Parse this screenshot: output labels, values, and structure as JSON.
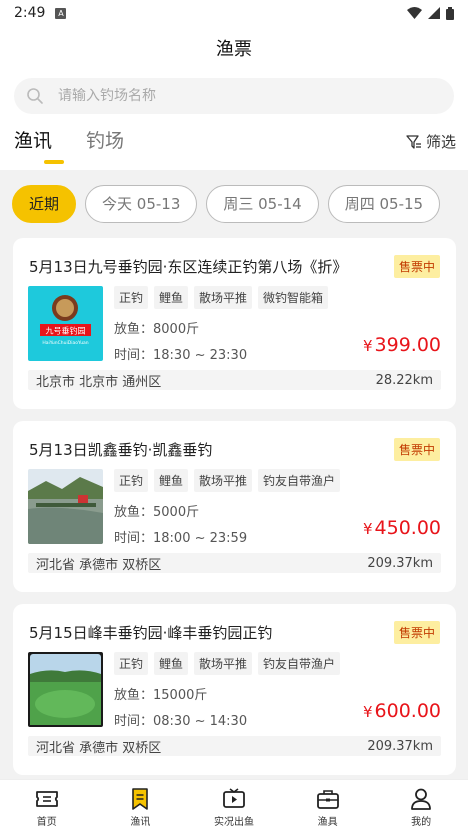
{
  "status": {
    "time": "2:49",
    "app_icon": "A"
  },
  "header": {
    "title": "渔票"
  },
  "search": {
    "placeholder": "请输入钓场名称"
  },
  "tabs": [
    {
      "label": "渔讯",
      "active": true
    },
    {
      "label": "钓场",
      "active": false
    }
  ],
  "filter": {
    "label": "筛选"
  },
  "dates": [
    {
      "label": "近期",
      "active": true
    },
    {
      "label": "今天 05-13",
      "active": false
    },
    {
      "label": "周三 05-14",
      "active": false
    },
    {
      "label": "周四 05-15",
      "active": false
    }
  ],
  "cards": [
    {
      "title": "5月13日九号垂钓园·东区连续正钓第八场《折》",
      "badge": "售票中",
      "tags": [
        "正钓",
        "鲤鱼",
        "散场平推",
        "微钓智能箱"
      ],
      "release": "放鱼：8000斤",
      "time": "时间：18:30 ~ 23:30",
      "currency": "¥",
      "price": "399.00",
      "location": "北京市 北京市 通州区",
      "distance": "28.22km",
      "thumb_text": "九号垂钓园",
      "thumb_sub": "HaiYunChuiDiaoYuan"
    },
    {
      "title": "5月13日凯鑫垂钓·凯鑫垂钓",
      "badge": "售票中",
      "tags": [
        "正钓",
        "鲤鱼",
        "散场平推",
        "钓友自带渔户"
      ],
      "release": "放鱼：5000斤",
      "time": "时间：18:00 ~ 23:59",
      "currency": "¥",
      "price": "450.00",
      "location": "河北省 承德市 双桥区",
      "distance": "209.37km"
    },
    {
      "title": "5月15日峰丰垂钓园·峰丰垂钓园正钓",
      "badge": "售票中",
      "tags": [
        "正钓",
        "鲤鱼",
        "散场平推",
        "钓友自带渔户"
      ],
      "release": "放鱼：15000斤",
      "time": "时间：08:30 ~ 14:30",
      "currency": "¥",
      "price": "600.00",
      "location": "河北省 承德市 双桥区",
      "distance": "209.37km"
    }
  ],
  "bottom_nav": [
    {
      "label": "首页",
      "icon": "ticket-icon"
    },
    {
      "label": "渔讯",
      "icon": "bookmark-icon",
      "active": true
    },
    {
      "label": "实况出鱼",
      "icon": "tv-play-icon"
    },
    {
      "label": "渔具",
      "icon": "toolbox-icon"
    },
    {
      "label": "我的",
      "icon": "user-icon"
    }
  ],
  "colors": {
    "accent": "#f5c200",
    "price": "#e8141a",
    "badge_bg": "#fdeea0",
    "badge_text": "#c23a00"
  }
}
